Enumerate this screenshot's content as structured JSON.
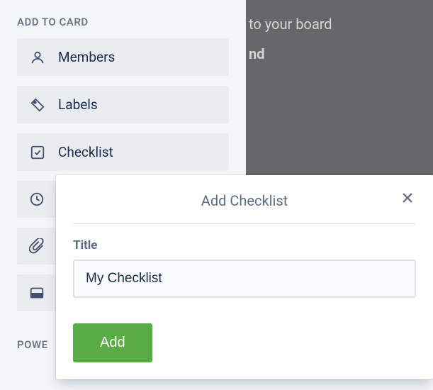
{
  "sidebar": {
    "section_title": "ADD TO CARD",
    "items": [
      {
        "label": "Members",
        "icon": "person-icon"
      },
      {
        "label": "Labels",
        "icon": "tag-icon"
      },
      {
        "label": "Checklist",
        "icon": "checklist-icon"
      },
      {
        "label": "",
        "icon": "clock-icon"
      },
      {
        "label": "",
        "icon": "attachment-icon"
      },
      {
        "label": "",
        "icon": "cover-icon"
      }
    ],
    "power_section": "POWE"
  },
  "overlay": {
    "line1": "to your board",
    "line2": "nd"
  },
  "popup": {
    "title": "Add Checklist",
    "field_label": "Title",
    "input_value": "My Checklist",
    "add_button": "Add"
  }
}
